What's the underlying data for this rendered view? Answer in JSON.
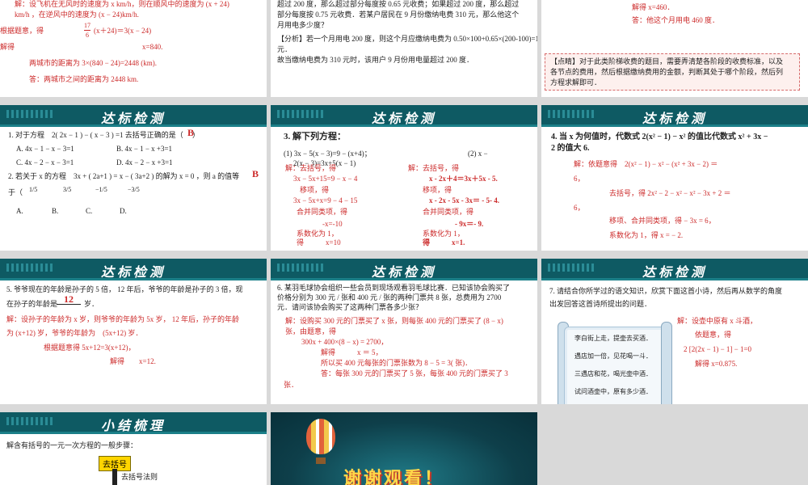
{
  "colors": {
    "banner": "#0e5a63",
    "answer_red": "#cc2a2a",
    "analysis_blue": "#1f4fb5",
    "background": "#d9d9d9",
    "flow_box": "#ffd500"
  },
  "banner_title": "达标检测",
  "summary_title": "小结梳理",
  "s1": {
    "l1": "解：设飞机在无风时的速度为 x km/h，则在顺风中的速度为 (x + 24)",
    "l2": "km/h ，在逆风中的速度为 (x − 24)km/h.",
    "l3a": "根据题意，得",
    "l3b": "17",
    "l3c": "6",
    "l3d": "(x＋24)＝3(x − 24)",
    "l4a": "解得",
    "l4b": "x=840.",
    "l5": "两城市的距离为 3×(840 − 24)=2448 (km).",
    "l6": "答：两城市之间的距离为 2448 km."
  },
  "s2": {
    "l1": "超过 200 度，那么超过部分每度按 0.65 元收费；如果超过 200 度，那么超过",
    "l2": "部分每度按 0.75 元收费．若某户居民在 9 月份缴纳电费 310 元，那么他这个",
    "l3": "月用电多少度？",
    "a1": "【分析】若一个月用电 200 度，则这个月应缴纳电费为 0.50×100+0.65×(200-100)=115",
    "a2": "元．",
    "a3": "故当缴纳电费为 310 元时，该用户 9 月份用电量超过 200 度．"
  },
  "s3": {
    "l1": "解得 x=460．",
    "l2": "答：他这个月用电 460 度．",
    "tip1": "【点睛】对于此类阶梯收费的题目，需要弄清楚各阶段的收费标准，以及",
    "tip2": "各节点的费用，然后根据缴纳费用的金额，判断其处于哪个阶段，然后列",
    "tip3": "方程求解即可．"
  },
  "s4": {
    "q1": "1. 对于方程　2( 2x − 1 ) − ( x − 3 ) =1 去括号正确的是（　 ）",
    "q1_ans": "B",
    "q1_a": "A. 4x − 1 − x − 3=1",
    "q1_b": "B. 4x − 1 − x +3=1",
    "q1_c": "C. 4x − 2 − x − 3=1",
    "q1_d": "D. 4x − 2 − x +3=1",
    "q2a": "2. 若关于 x 的方程　3x + ( 2a+1 ) = x − ( 3a+2 ) 的解为 x = 0 ，则 a 的值等",
    "q2_ans": "B",
    "q2b": "于（",
    "q2_o1": "1/5",
    "q2_o2": "3/5",
    "q2_o3": "−1/5",
    "q2_o4": "−3/5",
    "q2_la": "A.",
    "q2_lb": "B.",
    "q2_lc": "C.",
    "q2_ld": "D."
  },
  "s5": {
    "title": "3. 解下列方程：",
    "e1": "(1) 3x − 5(x − 3)=9 − (x+4)；",
    "e2a": "(2) x −",
    "e2b": "2(x − 3)=3x+5(x − 1)",
    "c1": [
      "解：去括号，得",
      "3x − 5x+15=9 − x − 4",
      "移项，得",
      "3x − 5x+x=9 − 4 − 15",
      "合并同类项，得",
      "-x=-10",
      "系数化为 1，",
      "得　　　x=10"
    ],
    "c2": [
      "解：去括号，得",
      "x - 2x＋4＝3x＋5x - 5.",
      "移项，得",
      "x - 2x - 5x - 3x＝ - 5- 4.",
      "合并同类项，得",
      "- 9x＝- 9.",
      "系数化为 1，",
      "得　　　x=1."
    ]
  },
  "s6": {
    "q1": "4. 当 x 为何值时，代数式 2(x² − 1) − x² 的值比代数式 x² + 3x −",
    "q2": "2 的值大 6.",
    "a1": "解：依题意得　2(x² − 1) − x² − (x² + 3x − 2) ＝",
    "a2": "6，",
    "a3": "去括号，得 2x² − 2 − x² − x² − 3x + 2 ＝",
    "a4": "6，",
    "a5": "移项、合并同类项，得 − 3x = 6，",
    "a6": "系数化为 1，得 x = − 2."
  },
  "s7": {
    "q1": "5. 爷爷现在的年龄是孙子的 5 倍， 12 年后，爷爷的年龄是孙子的 3 倍，现",
    "q2": "在孙子的年龄是",
    "q2_blank": "12",
    "q2_end": "岁．",
    "a1": "解：设孙子的年龄为 x 岁，则爷爷的年龄为 5x 岁， 12 年后，孙子的年龄",
    "a2": "为 (x+12) 岁，爷爷的年龄为　(5x+12) 岁．",
    "a3": "根据题意得 5x+12=3(x+12)，",
    "a4": "解得　　x=12."
  },
  "s8": {
    "q1": "6. 某羽毛球协会组织一些会员到现场观看羽毛球比赛．已知该协会购买了",
    "q2": "价格分别为 300 元 / 张和 400 元 / 张的两种门票共 8 张，总费用为 2700",
    "q3": "元．请问该协会购买了这两种门票各多少张？",
    "a1": "解：设购买 300 元的门票买了 x 张，则每张 400 元的门票买了 (8 − x)",
    "a2": "张，由题意，得",
    "a3": "300x + 400×(8 − x) = 2700，",
    "a4": "解得　　　x ＝ 5，",
    "a5": "所以买 400 元每张的门票张数为 8 − 5 = 3( 张)．",
    "a6": "答：每张 300 元的门票买了 5 张，每张 400 元的门票买了 3",
    "a7": "张．"
  },
  "s9": {
    "q1": "7. 请结合你所学过的语文知识，欣赏下面这首小诗，然后再从数学的角度",
    "q2": "出发回答这首诗所提出的问题．",
    "poem": [
      "李白街上走，提壶去买酒．",
      "遇店加一倍，见花喝一斗．",
      "三遇店和花，喝光壶中酒．",
      "试问酒壶中，原有多少酒．"
    ],
    "a1": "解：设壶中原有 x 斗酒，",
    "a2": "依题意，得",
    "a3": "2 [2(2x − 1) − 1] − 1=0",
    "a4": "解得 x=0.875."
  },
  "s10": {
    "intro": "解含有括号的一元一次方程的一般步骤：",
    "box": "去括号",
    "rule": "去括号法则"
  },
  "s11": {
    "text": "谢谢观看！"
  }
}
